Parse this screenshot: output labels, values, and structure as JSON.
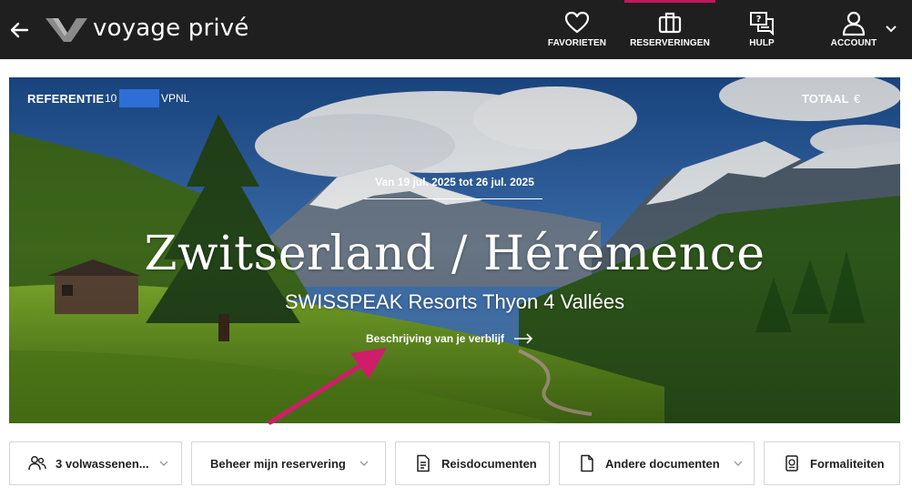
{
  "header": {
    "brand": "voyage privé",
    "nav": [
      {
        "label": "FAVORIETEN",
        "icon": "heart-icon"
      },
      {
        "label": "RESERVERINGEN",
        "icon": "suitcase-icon",
        "active": true
      },
      {
        "label": "HULP",
        "icon": "help-chat-icon"
      },
      {
        "label": "ACCOUNT",
        "icon": "user-icon"
      }
    ],
    "active_color": "#c2185b"
  },
  "booking": {
    "reference_label": "REFERENTIE",
    "reference_prefix": "10",
    "reference_suffix": "VPNL",
    "total_label": "TOTAAL",
    "total_value": "€",
    "dates": "Van 19 jul. 2025 tot 26 jul. 2025",
    "destination": "Zwitserland / Hérémence",
    "hotel": "SWISSPEAK Resorts Thyon 4 Vallées",
    "description_link": "Beschrijving van je verblijf"
  },
  "actions": [
    {
      "label": "3 volwassenen...",
      "icon": "people-icon",
      "dropdown": true
    },
    {
      "label": "Beheer mijn reservering",
      "icon": "",
      "dropdown": true
    },
    {
      "label": "Reisdocumenten",
      "icon": "document-icon",
      "dropdown": false
    },
    {
      "label": "Andere documenten",
      "icon": "file-icon",
      "dropdown": true
    },
    {
      "label": "Formaliteiten",
      "icon": "passport-icon",
      "dropdown": false
    }
  ],
  "annotation_color": "#d01d6a"
}
